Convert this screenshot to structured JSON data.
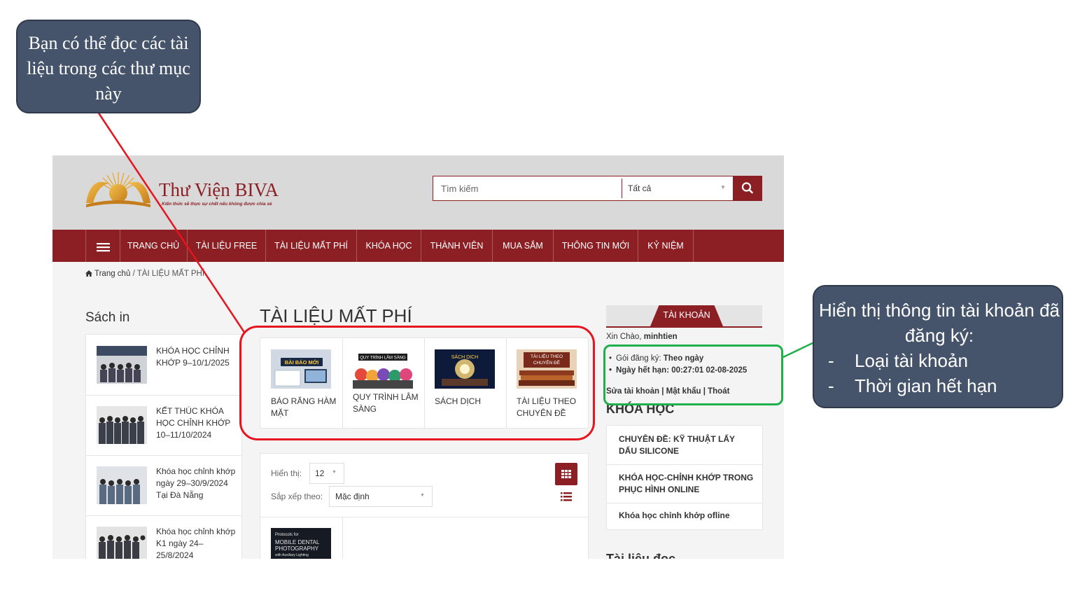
{
  "header": {
    "logo_title": "Thư Viện BIVA",
    "logo_tagline": "Kiến thức sẽ thực sự chết nếu không được chia sẻ",
    "search_placeholder": "Tìm kiếm",
    "search_category": "Tất cả"
  },
  "nav": {
    "items": [
      "TRANG CHỦ",
      "TÀI LIỆU FREE",
      "TÀI LIỆU MẤT PHÍ",
      "KHÓA HỌC",
      "THÀNH VIÊN",
      "MUA SẮM",
      "THÔNG TIN MỚI",
      "KỶ NIỆM"
    ]
  },
  "breadcrumb": {
    "home": "Trang chủ",
    "separator": "/",
    "current": "TÀI LIỆU MẤT PHÍ"
  },
  "left": {
    "title": "Sách in",
    "items": [
      {
        "text": "KHÓA HỌC CHỈNH KHỚP 9–10/1/2025"
      },
      {
        "text": "KẾT THÚC KHÓA HỌC CHỈNH KHỚP 10–11/10/2024"
      },
      {
        "text": "Khóa học chỉnh khớp ngày 29–30/9/2024 Tại Đà Nẵng"
      },
      {
        "text": "Khóa học chỉnh khớp K1 ngày 24–25/8/2024"
      }
    ]
  },
  "main": {
    "title": "TÀI LIỆU MẤT PHÍ",
    "categories": [
      {
        "label": "BÁO RĂNG HÀM MẶT",
        "image_text": "BÀI BÁO MỚI"
      },
      {
        "label": "QUY TRÌNH LÂM SÀNG",
        "image_text": "QUY TRÌNH LÂM SÀNG"
      },
      {
        "label": "SÁCH DỊCH",
        "image_text": "SÁCH DỊCH"
      },
      {
        "label": "TÀI LIỆU THEO CHUYÊN ĐỀ",
        "image_text": "TÀI LIỆU THEO CHUYÊN ĐỀ"
      }
    ],
    "show_label": "Hiển thị:",
    "show_value": "12",
    "sort_label": "Sắp xếp theo:",
    "sort_value": "Mặc định",
    "product_thumb_text": [
      "Protocols for",
      "MOBILE DENTAL",
      "PHOTOGRAPHY",
      "with Auxiliary Lighting"
    ]
  },
  "account": {
    "tab": "TÀI KHOẢN",
    "greeting": "Xin Chào,",
    "username": "minhtien",
    "plan_label": "Gói đăng ký:",
    "plan_value": "Theo ngày",
    "expiry_label": "Ngày hết hạn:",
    "expiry_value": "00:27:01 02-08-2025",
    "links": "Sửa tài khoản | Mật khẩu | Thoát"
  },
  "courses": {
    "title": "KHÓA HỌC",
    "items": [
      "CHUYÊN ĐỀ: KỸ THUẬT LẤY DẤU SILICONE",
      "KHÓA HỌC-CHỈNH KHỚP TRONG PHỤC HÌNH ONLINE",
      "Khóa học chỉnh khớp ofline"
    ]
  },
  "read_section": {
    "title": "Tài liệu đọc"
  },
  "annotations": {
    "left_callout": "Bạn có thể đọc các tài liệu trong các thư mục này",
    "right_callout_title": "Hiển thị thông tin tài khoản đã đăng ký:",
    "right_bullets": [
      "Loại tài khoản",
      "Thời gian hết hạn"
    ],
    "bullet_marker": "-"
  },
  "colors": {
    "brand": "#8b1f24",
    "callout": "#45546a",
    "red_highlight": "#e5141f",
    "green_highlight": "#1fb04b"
  },
  "icons": [
    "hamburger-icon",
    "search-icon",
    "home-icon",
    "grid-view-icon",
    "list-view-icon",
    "dropdown-caret-icon"
  ]
}
